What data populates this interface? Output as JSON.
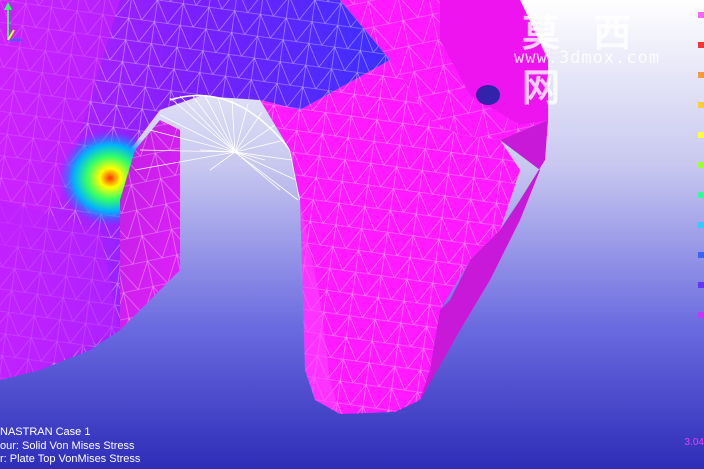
{
  "watermark": {
    "logo_text": "莫 西 网",
    "url": "www.3dmox.com"
  },
  "status_lines": [
    "NASTRAN Case 1",
    "our: Solid Von Mises Stress",
    "r: Plate Top VonMises Stress"
  ],
  "legend": {
    "min_value": "3.04",
    "colors": [
      "#ff66ff",
      "#ff3333",
      "#ff9933",
      "#ffcc33",
      "#ffff33",
      "#99ff33",
      "#33ff99",
      "#33ccff",
      "#3366ff",
      "#6633ff",
      "#cc33ff"
    ]
  },
  "colors": {
    "background_top": "#ffffff",
    "background_bottom": "#3a3ac8",
    "part_magenta": "#ff1aff",
    "part_purple": "#9a1aff",
    "stress_hot": "#ffff00",
    "stress_mid": "#00c0ff"
  },
  "icons": {
    "axis_triad": "xyz-axis-triad-icon"
  }
}
